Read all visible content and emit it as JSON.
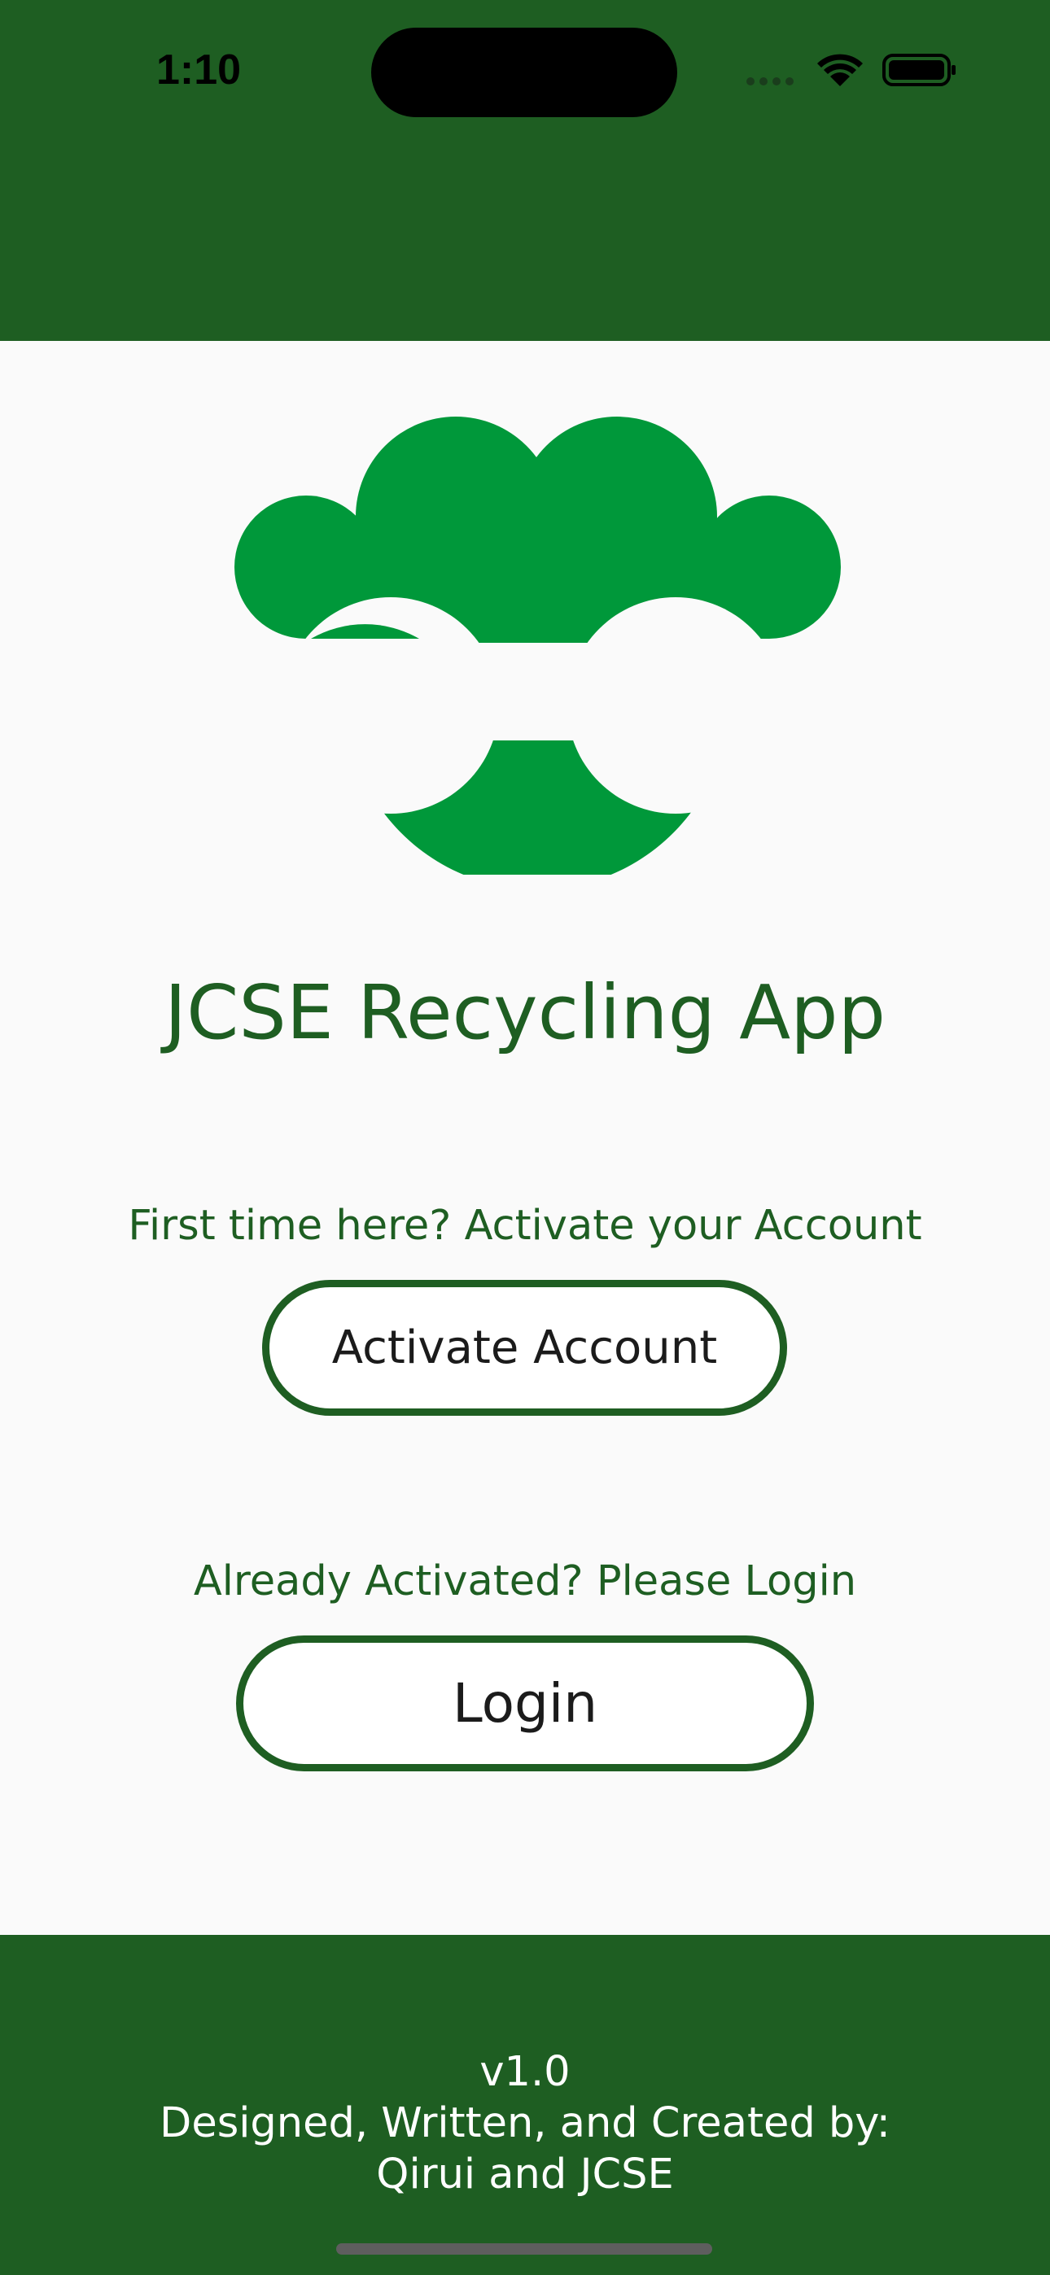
{
  "status_bar": {
    "time": "1:10",
    "icons": [
      "signal-dots-icon",
      "wifi-icon",
      "battery-icon"
    ]
  },
  "colors": {
    "header": "#1e5e22",
    "logo": "#00983a",
    "background": "#fafafa",
    "text_accent": "#1e5e22"
  },
  "app": {
    "title": "JCSE Recycling App",
    "logo_icon": "tree-logo-icon"
  },
  "activate": {
    "prompt": "First time here? Activate your Account",
    "button_label": "Activate Account"
  },
  "login": {
    "prompt": "Already Activated? Please Login",
    "button_label": "Login"
  },
  "footer": {
    "version": "v1.0",
    "credit_line": "Designed, Written, and Created by:",
    "authors": "Qirui and JCSE"
  }
}
